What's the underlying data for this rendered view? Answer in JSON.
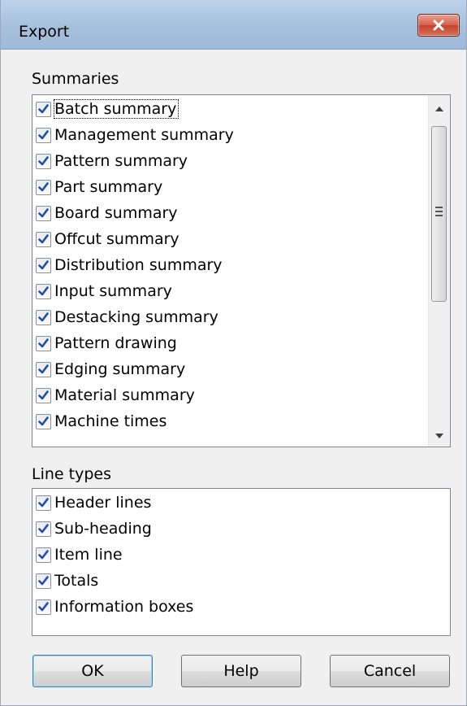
{
  "window": {
    "title": "Export"
  },
  "summaries": {
    "label": "Summaries",
    "items": [
      {
        "label": "Batch summary",
        "checked": true
      },
      {
        "label": "Management summary",
        "checked": true
      },
      {
        "label": "Pattern summary",
        "checked": true
      },
      {
        "label": "Part summary",
        "checked": true
      },
      {
        "label": "Board summary",
        "checked": true
      },
      {
        "label": "Offcut summary",
        "checked": true
      },
      {
        "label": "Distribution summary",
        "checked": true
      },
      {
        "label": "Input summary",
        "checked": true
      },
      {
        "label": "Destacking summary",
        "checked": true
      },
      {
        "label": "Pattern drawing",
        "checked": true
      },
      {
        "label": "Edging summary",
        "checked": true
      },
      {
        "label": "Material summary",
        "checked": true
      },
      {
        "label": "Machine times",
        "checked": true
      }
    ]
  },
  "line_types": {
    "label": "Line types",
    "items": [
      {
        "label": "Header lines",
        "checked": true
      },
      {
        "label": "Sub-heading",
        "checked": true
      },
      {
        "label": "Item line",
        "checked": true
      },
      {
        "label": "Totals",
        "checked": true
      },
      {
        "label": "Information boxes",
        "checked": true
      }
    ]
  },
  "buttons": {
    "ok": "OK",
    "help": "Help",
    "cancel": "Cancel"
  },
  "colors": {
    "checkmark": "#1e4fa5",
    "titlebar": "#a6c0dc",
    "close_button": "#c5432a"
  }
}
